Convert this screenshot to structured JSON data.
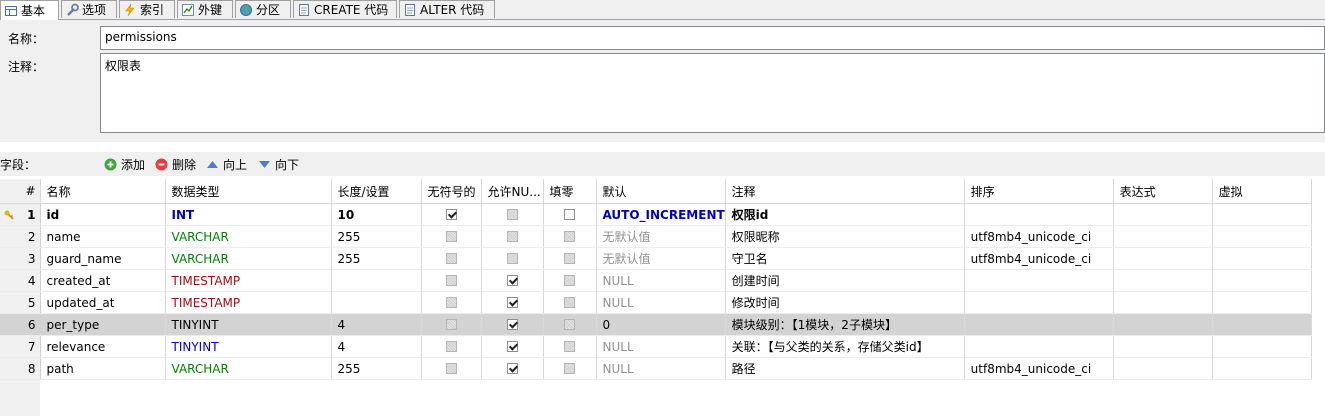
{
  "tabs": [
    {
      "label": "基本",
      "icon": "table-icon",
      "active": true
    },
    {
      "label": "选项",
      "icon": "wrench-icon"
    },
    {
      "label": "索引",
      "icon": "lightning-icon"
    },
    {
      "label": "外键",
      "icon": "chart-icon"
    },
    {
      "label": "分区",
      "icon": "globe-icon"
    },
    {
      "label": "CREATE 代码",
      "icon": "document-icon"
    },
    {
      "label": "ALTER 代码",
      "icon": "document-icon"
    }
  ],
  "form": {
    "name_label": "名称：",
    "name_value": "permissions",
    "comment_label": "注释：",
    "comment_value": "权限表"
  },
  "toolbar": {
    "fields_label": "字段：",
    "add": "添加",
    "delete": "删除",
    "up": "向上",
    "down": "向下"
  },
  "columns": [
    "#",
    "名称",
    "数据类型",
    "长度/设置",
    "无符号的",
    "允许NU...",
    "填零",
    "默认",
    "注释",
    "排序",
    "表达式",
    "虚拟"
  ],
  "rows": [
    {
      "num": "1",
      "name": "id",
      "type": "INT",
      "length": "10",
      "unsigned": true,
      "nullable": false,
      "zerofill": false,
      "default": "AUTO_INCREMENT",
      "comment": "权限id",
      "collation": "",
      "pk": true
    },
    {
      "num": "2",
      "name": "name",
      "type": "VARCHAR",
      "length": "255",
      "unsigned": false,
      "nullable": false,
      "zerofill": false,
      "default": "无默认值",
      "comment": "权限昵称",
      "collation": "utf8mb4_unicode_ci"
    },
    {
      "num": "3",
      "name": "guard_name",
      "type": "VARCHAR",
      "length": "255",
      "unsigned": false,
      "nullable": false,
      "zerofill": false,
      "default": "无默认值",
      "comment": "守卫名",
      "collation": "utf8mb4_unicode_ci"
    },
    {
      "num": "4",
      "name": "created_at",
      "type": "TIMESTAMP",
      "length": "",
      "unsigned": false,
      "nullable": true,
      "zerofill": false,
      "default": "NULL",
      "comment": "创建时间",
      "collation": ""
    },
    {
      "num": "5",
      "name": "updated_at",
      "type": "TIMESTAMP",
      "length": "",
      "unsigned": false,
      "nullable": true,
      "zerofill": false,
      "default": "NULL",
      "comment": "修改时间",
      "collation": ""
    },
    {
      "num": "6",
      "name": "per_type",
      "type": "TINYINT",
      "length": "4",
      "unsigned": false,
      "nullable": true,
      "zerofill": false,
      "default": "0",
      "comment": "模块级别：【1模块，2子模块】",
      "collation": "",
      "selected": true
    },
    {
      "num": "7",
      "name": "relevance",
      "type": "TINYINT",
      "length": "4",
      "unsigned": false,
      "nullable": true,
      "zerofill": false,
      "default": "NULL",
      "comment": "关联：【与父类的关系，存储父类id】",
      "collation": ""
    },
    {
      "num": "8",
      "name": "path",
      "type": "VARCHAR",
      "length": "255",
      "unsigned": false,
      "nullable": true,
      "zerofill": false,
      "default": "NULL",
      "comment": "路径",
      "collation": "utf8mb4_unicode_ci"
    }
  ],
  "colors": {
    "int_type": "#0000c8",
    "string_type": "#008000",
    "date_type": "#a01010",
    "selected_row": "#d3d3d3"
  }
}
